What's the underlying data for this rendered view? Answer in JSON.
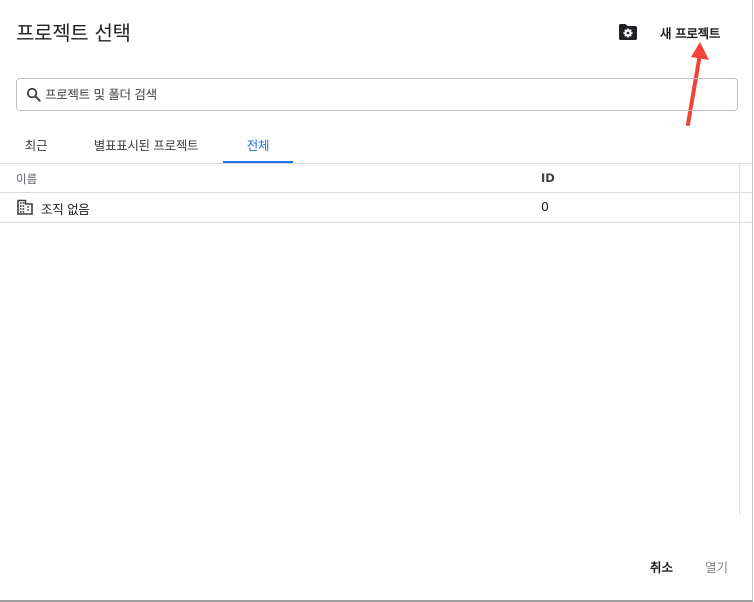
{
  "dialog": {
    "title": "프로젝트 선택"
  },
  "header": {
    "settings_icon": "folder-gear-icon",
    "new_project_label": "새 프로젝트"
  },
  "search": {
    "placeholder": "프로젝트 및 폴더 검색",
    "value": ""
  },
  "tabs": [
    {
      "label": "최근",
      "active": false
    },
    {
      "label": "별표표시된 프로젝트",
      "active": false
    },
    {
      "label": "전체",
      "active": true
    }
  ],
  "table": {
    "columns": [
      "이름",
      "ID"
    ],
    "rows": [
      {
        "icon": "building-icon",
        "name": "조직 없음",
        "id": "0"
      }
    ]
  },
  "footer": {
    "cancel_label": "취소",
    "open_label": "열기"
  },
  "colors": {
    "accent": "#1a73e8",
    "annotation_arrow": "#f44336"
  }
}
